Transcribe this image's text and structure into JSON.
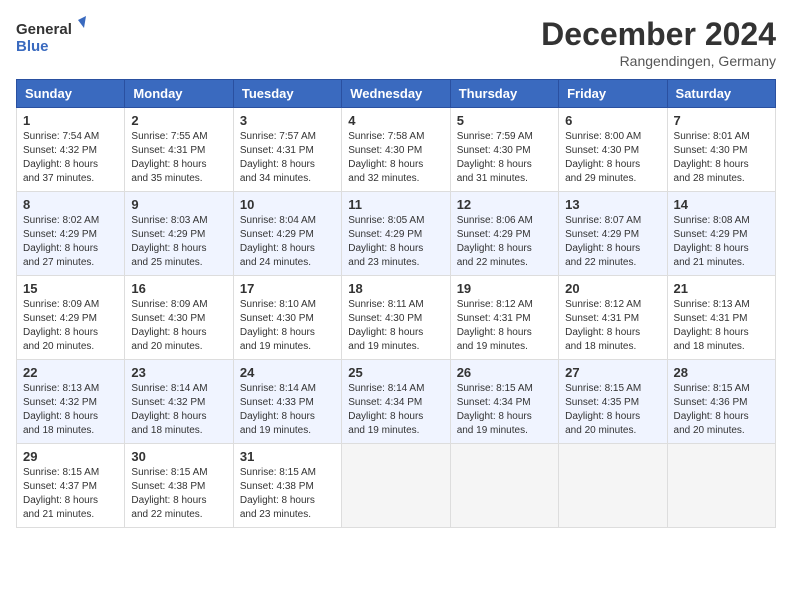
{
  "logo": {
    "line1": "General",
    "line2": "Blue"
  },
  "title": "December 2024",
  "location": "Rangendingen, Germany",
  "days_header": [
    "Sunday",
    "Monday",
    "Tuesday",
    "Wednesday",
    "Thursday",
    "Friday",
    "Saturday"
  ],
  "weeks": [
    [
      {
        "num": "1",
        "info": "Sunrise: 7:54 AM\nSunset: 4:32 PM\nDaylight: 8 hours\nand 37 minutes."
      },
      {
        "num": "2",
        "info": "Sunrise: 7:55 AM\nSunset: 4:31 PM\nDaylight: 8 hours\nand 35 minutes."
      },
      {
        "num": "3",
        "info": "Sunrise: 7:57 AM\nSunset: 4:31 PM\nDaylight: 8 hours\nand 34 minutes."
      },
      {
        "num": "4",
        "info": "Sunrise: 7:58 AM\nSunset: 4:30 PM\nDaylight: 8 hours\nand 32 minutes."
      },
      {
        "num": "5",
        "info": "Sunrise: 7:59 AM\nSunset: 4:30 PM\nDaylight: 8 hours\nand 31 minutes."
      },
      {
        "num": "6",
        "info": "Sunrise: 8:00 AM\nSunset: 4:30 PM\nDaylight: 8 hours\nand 29 minutes."
      },
      {
        "num": "7",
        "info": "Sunrise: 8:01 AM\nSunset: 4:30 PM\nDaylight: 8 hours\nand 28 minutes."
      }
    ],
    [
      {
        "num": "8",
        "info": "Sunrise: 8:02 AM\nSunset: 4:29 PM\nDaylight: 8 hours\nand 27 minutes."
      },
      {
        "num": "9",
        "info": "Sunrise: 8:03 AM\nSunset: 4:29 PM\nDaylight: 8 hours\nand 25 minutes."
      },
      {
        "num": "10",
        "info": "Sunrise: 8:04 AM\nSunset: 4:29 PM\nDaylight: 8 hours\nand 24 minutes."
      },
      {
        "num": "11",
        "info": "Sunrise: 8:05 AM\nSunset: 4:29 PM\nDaylight: 8 hours\nand 23 minutes."
      },
      {
        "num": "12",
        "info": "Sunrise: 8:06 AM\nSunset: 4:29 PM\nDaylight: 8 hours\nand 22 minutes."
      },
      {
        "num": "13",
        "info": "Sunrise: 8:07 AM\nSunset: 4:29 PM\nDaylight: 8 hours\nand 22 minutes."
      },
      {
        "num": "14",
        "info": "Sunrise: 8:08 AM\nSunset: 4:29 PM\nDaylight: 8 hours\nand 21 minutes."
      }
    ],
    [
      {
        "num": "15",
        "info": "Sunrise: 8:09 AM\nSunset: 4:29 PM\nDaylight: 8 hours\nand 20 minutes."
      },
      {
        "num": "16",
        "info": "Sunrise: 8:09 AM\nSunset: 4:30 PM\nDaylight: 8 hours\nand 20 minutes."
      },
      {
        "num": "17",
        "info": "Sunrise: 8:10 AM\nSunset: 4:30 PM\nDaylight: 8 hours\nand 19 minutes."
      },
      {
        "num": "18",
        "info": "Sunrise: 8:11 AM\nSunset: 4:30 PM\nDaylight: 8 hours\nand 19 minutes."
      },
      {
        "num": "19",
        "info": "Sunrise: 8:12 AM\nSunset: 4:31 PM\nDaylight: 8 hours\nand 19 minutes."
      },
      {
        "num": "20",
        "info": "Sunrise: 8:12 AM\nSunset: 4:31 PM\nDaylight: 8 hours\nand 18 minutes."
      },
      {
        "num": "21",
        "info": "Sunrise: 8:13 AM\nSunset: 4:31 PM\nDaylight: 8 hours\nand 18 minutes."
      }
    ],
    [
      {
        "num": "22",
        "info": "Sunrise: 8:13 AM\nSunset: 4:32 PM\nDaylight: 8 hours\nand 18 minutes."
      },
      {
        "num": "23",
        "info": "Sunrise: 8:14 AM\nSunset: 4:32 PM\nDaylight: 8 hours\nand 18 minutes."
      },
      {
        "num": "24",
        "info": "Sunrise: 8:14 AM\nSunset: 4:33 PM\nDaylight: 8 hours\nand 19 minutes."
      },
      {
        "num": "25",
        "info": "Sunrise: 8:14 AM\nSunset: 4:34 PM\nDaylight: 8 hours\nand 19 minutes."
      },
      {
        "num": "26",
        "info": "Sunrise: 8:15 AM\nSunset: 4:34 PM\nDaylight: 8 hours\nand 19 minutes."
      },
      {
        "num": "27",
        "info": "Sunrise: 8:15 AM\nSunset: 4:35 PM\nDaylight: 8 hours\nand 20 minutes."
      },
      {
        "num": "28",
        "info": "Sunrise: 8:15 AM\nSunset: 4:36 PM\nDaylight: 8 hours\nand 20 minutes."
      }
    ],
    [
      {
        "num": "29",
        "info": "Sunrise: 8:15 AM\nSunset: 4:37 PM\nDaylight: 8 hours\nand 21 minutes."
      },
      {
        "num": "30",
        "info": "Sunrise: 8:15 AM\nSunset: 4:38 PM\nDaylight: 8 hours\nand 22 minutes."
      },
      {
        "num": "31",
        "info": "Sunrise: 8:15 AM\nSunset: 4:38 PM\nDaylight: 8 hours\nand 23 minutes."
      },
      null,
      null,
      null,
      null
    ]
  ]
}
